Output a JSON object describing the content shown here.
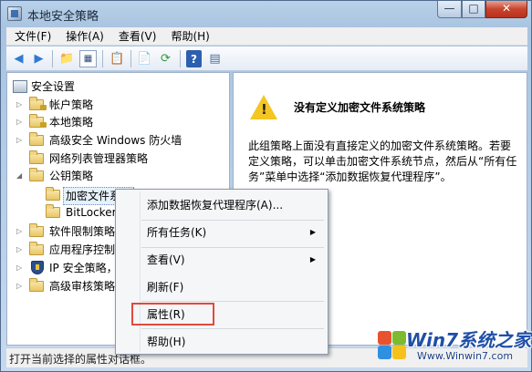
{
  "window": {
    "title": "本地安全策略",
    "minimize": "—",
    "maximize": "□",
    "close": "✕"
  },
  "menu": [
    "文件(F)",
    "操作(A)",
    "查看(V)",
    "帮助(H)"
  ],
  "toolbar": {
    "back": "◀",
    "forward": "▶",
    "up": "📁",
    "tree": "▦",
    "clipboard": "📋",
    "export": "📄",
    "refresh": "⟳",
    "help": "?",
    "grid": "▤"
  },
  "tree": {
    "root": "安全设置",
    "items": [
      "帐户策略",
      "本地策略",
      "高级安全 Windows 防火墙",
      "网络列表管理器策略",
      "公钥策略",
      "加密文件系统",
      "BitLocker",
      "软件限制策略",
      "应用程序控制",
      "IP 安全策略，",
      "高级审核策略配"
    ]
  },
  "content": {
    "title": "没有定义加密文件系统策略",
    "body": "此组策略上面没有直接定义的加密文件系统策略。若要定义策略，可以单击加密文件系统节点，然后从“所有任务”菜单中选择“添加数据恢复代理程序”。"
  },
  "context_menu": {
    "add_agent": "添加数据恢复代理程序(A)...",
    "all_tasks": "所有任务(K)",
    "view": "查看(V)",
    "refresh": "刷新(F)",
    "properties": "属性(R)",
    "help": "帮助(H)"
  },
  "status": "打开当前选择的属性对话框。",
  "watermark": {
    "title": "Win7系统之家",
    "url": "Www.Winwin7.com"
  }
}
